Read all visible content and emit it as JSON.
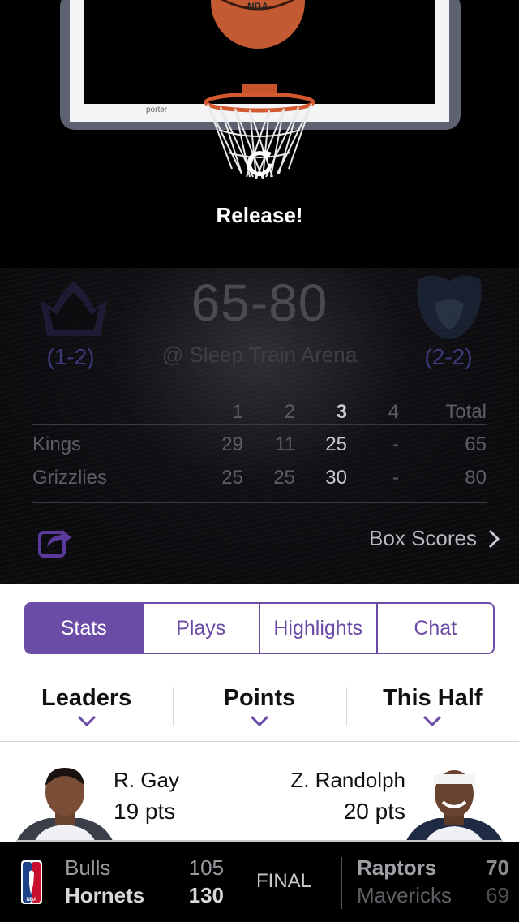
{
  "refresh": {
    "status_text": "Release!",
    "hoop_brand": "porter",
    "ball_brand": "NBA"
  },
  "game": {
    "home_record": "(1-2)",
    "away_record": "(2-2)",
    "score": "65-80",
    "venue": "@ Sleep Train Arena",
    "quarters_header": [
      "1",
      "2",
      "3",
      "4",
      "Total"
    ],
    "current_quarter": "3",
    "rows": [
      {
        "team": "Kings",
        "q": [
          "29",
          "11",
          "25",
          "-"
        ],
        "total": "65"
      },
      {
        "team": "Grizzlies",
        "q": [
          "25",
          "25",
          "30",
          "-"
        ],
        "total": "80"
      }
    ],
    "box_scores_label": "Box Scores"
  },
  "tabs": [
    {
      "label": "Stats",
      "active": true
    },
    {
      "label": "Plays",
      "active": false
    },
    {
      "label": "Highlights",
      "active": false
    },
    {
      "label": "Chat",
      "active": false
    }
  ],
  "filters": [
    {
      "label": "Leaders"
    },
    {
      "label": "Points"
    },
    {
      "label": "This Half"
    }
  ],
  "leaders": {
    "left": {
      "name": "R. Gay",
      "stat": "19 pts"
    },
    "right": {
      "name": "Z. Randolph",
      "stat": "20 pts"
    }
  },
  "ticker": {
    "game1": {
      "team1": "Bulls",
      "score1": "105",
      "team2": "Hornets",
      "score2": "130",
      "status": "FINAL"
    },
    "game2": {
      "team1": "Raptors",
      "score1": "70",
      "team2": "Mavericks",
      "score2": "69"
    }
  },
  "colors": {
    "accent": "#6a4ba6",
    "kings_purple": "#5a2d91",
    "background": "#000000"
  }
}
